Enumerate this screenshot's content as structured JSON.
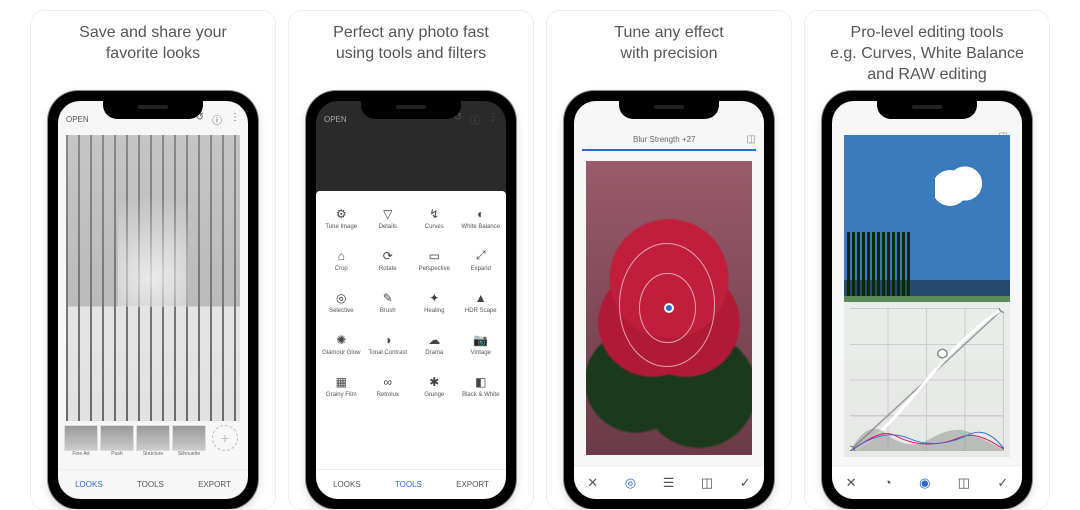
{
  "panels": [
    {
      "title": "Save and share your\nfavorite looks"
    },
    {
      "title": "Perfect any photo fast\nusing tools and filters"
    },
    {
      "title": "Tune any effect\nwith precision"
    },
    {
      "title": "Pro-level editing tools\ne.g. Curves, White Balance\nand RAW editing"
    }
  ],
  "open_label": "OPEN",
  "tabs": {
    "looks": "LOOKS",
    "tools": "TOOLS",
    "export": "EXPORT"
  },
  "looks": [
    "Fine Art",
    "Push",
    "Structure",
    "Silhouette"
  ],
  "tools": [
    "Tune Image",
    "Details",
    "Curves",
    "White Balance",
    "Crop",
    "Rotate",
    "Perspective",
    "Expand",
    "Selective",
    "Brush",
    "Healing",
    "HDR Scape",
    "Glamour Glow",
    "Tonal Contrast",
    "Drama",
    "Vintage",
    "Grainy Film",
    "Retrolux",
    "Grunge",
    "Black & White"
  ],
  "tool_icons": [
    "⚙",
    "▽",
    "↯",
    "◐",
    "⌂",
    "⟳",
    "▭",
    "⤢",
    "◎",
    "✎",
    "✦",
    "▲",
    "✺",
    "◑",
    "☁",
    "📷",
    "▦",
    "∞",
    "✱",
    "◧"
  ],
  "effect_label": "Blur Strength +27",
  "edit_icons": {
    "cancel": "✕",
    "target": "◎",
    "sliders": "☰",
    "layers": "◫",
    "confirm": "✓",
    "curves": "◔",
    "eye": "◉"
  }
}
